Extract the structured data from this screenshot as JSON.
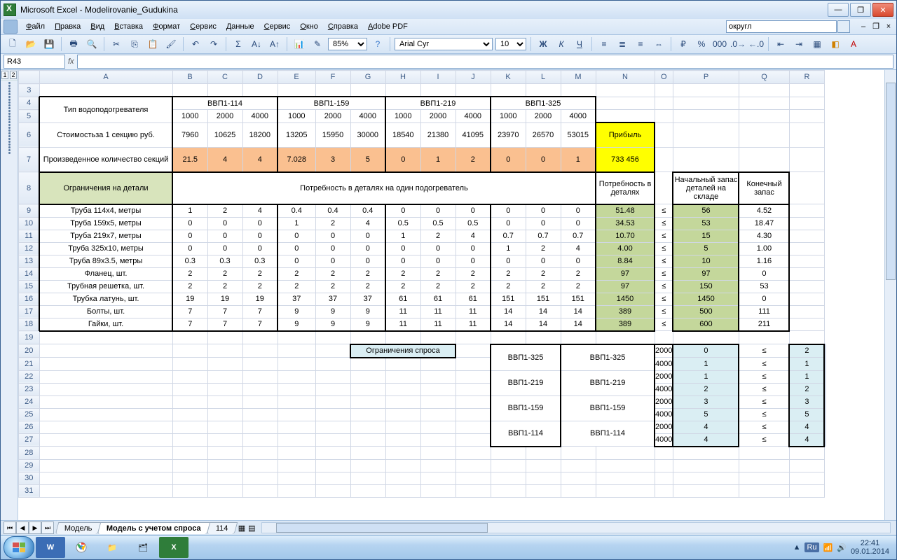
{
  "app_title": "Microsoft Excel - Modelirovanie_Gudukina",
  "menu": [
    "Файл",
    "Правка",
    "Вид",
    "Вставка",
    "Формат",
    "Сервис",
    "Данные",
    "Сервис",
    "Окно",
    "Справка",
    "Adobe PDF"
  ],
  "search_value": "округл",
  "zoom": "85%",
  "font_name": "Arial Cyr",
  "font_size": "10",
  "name_box": "R43",
  "columns": [
    "A",
    "B",
    "C",
    "D",
    "E",
    "F",
    "G",
    "H",
    "I",
    "J",
    "K",
    "L",
    "M",
    "N",
    "O",
    "P",
    "Q",
    "R"
  ],
  "row_start": 3,
  "row_end": 31,
  "labels": {
    "type": "Тип водоподогревателя",
    "cost": "Стоимостьза 1 секцию руб.",
    "produced": "Произведенное количество секций",
    "profit": "Прибыль",
    "profit_val": "733 456",
    "constraints": "Ограничения на детали",
    "need_per": "Потребность в деталях на один подогреватель",
    "need_total": "Потребность в деталях",
    "stock": "Начальный запас деталей на складе",
    "end_stock": "Конечный запас",
    "demand": "Ограничения спроса",
    "le": "≤"
  },
  "types": [
    "ВВП1-114",
    "ВВП1-159",
    "ВВП1-219",
    "ВВП1-325"
  ],
  "sizes": [
    "1000",
    "2000",
    "4000"
  ],
  "cost_row": [
    "7960",
    "10625",
    "18200",
    "13205",
    "15950",
    "30000",
    "18540",
    "21380",
    "41095",
    "23970",
    "26570",
    "53015"
  ],
  "prod_row": [
    "21.5",
    "4",
    "4",
    "7.028",
    "3",
    "5",
    "0",
    "1",
    "2",
    "0",
    "0",
    "1"
  ],
  "parts": [
    {
      "n": "Труба 114х4, метры",
      "v": [
        "1",
        "2",
        "4",
        "0.4",
        "0.4",
        "0.4",
        "0",
        "0",
        "0",
        "0",
        "0",
        "0"
      ],
      "need": "51.48",
      "stock": "56",
      "end": "4.52"
    },
    {
      "n": "Труба 159х5, метры",
      "v": [
        "0",
        "0",
        "0",
        "1",
        "2",
        "4",
        "0.5",
        "0.5",
        "0.5",
        "0",
        "0",
        "0"
      ],
      "need": "34.53",
      "stock": "53",
      "end": "18.47"
    },
    {
      "n": "Труба 219х7, метры",
      "v": [
        "0",
        "0",
        "0",
        "0",
        "0",
        "0",
        "1",
        "2",
        "4",
        "0.7",
        "0.7",
        "0.7"
      ],
      "need": "10.70",
      "stock": "15",
      "end": "4.30"
    },
    {
      "n": "Труба 325х10, метры",
      "v": [
        "0",
        "0",
        "0",
        "0",
        "0",
        "0",
        "0",
        "0",
        "0",
        "1",
        "2",
        "4"
      ],
      "need": "4.00",
      "stock": "5",
      "end": "1.00"
    },
    {
      "n": "Труба 89х3.5, метры",
      "v": [
        "0.3",
        "0.3",
        "0.3",
        "0",
        "0",
        "0",
        "0",
        "0",
        "0",
        "0",
        "0",
        "0"
      ],
      "need": "8.84",
      "stock": "10",
      "end": "1.16"
    },
    {
      "n": "Фланец, шт.",
      "v": [
        "2",
        "2",
        "2",
        "2",
        "2",
        "2",
        "2",
        "2",
        "2",
        "2",
        "2",
        "2"
      ],
      "need": "97",
      "stock": "97",
      "end": "0"
    },
    {
      "n": "Трубная решетка, шт.",
      "v": [
        "2",
        "2",
        "2",
        "2",
        "2",
        "2",
        "2",
        "2",
        "2",
        "2",
        "2",
        "2"
      ],
      "need": "97",
      "stock": "150",
      "end": "53"
    },
    {
      "n": "Трубка латунь, шт.",
      "v": [
        "19",
        "19",
        "19",
        "37",
        "37",
        "37",
        "61",
        "61",
        "61",
        "151",
        "151",
        "151"
      ],
      "need": "1450",
      "stock": "1450",
      "end": "0"
    },
    {
      "n": "Болты, шт.",
      "v": [
        "7",
        "7",
        "7",
        "9",
        "9",
        "9",
        "11",
        "11",
        "11",
        "14",
        "14",
        "14"
      ],
      "need": "389",
      "stock": "500",
      "end": "111"
    },
    {
      "n": "Гайки, шт.",
      "v": [
        "7",
        "7",
        "7",
        "9",
        "9",
        "9",
        "11",
        "11",
        "11",
        "14",
        "14",
        "14"
      ],
      "need": "389",
      "stock": "600",
      "end": "211"
    }
  ],
  "demand": [
    {
      "t": "ВВП1-325",
      "rows": [
        {
          "s": "2000",
          "a": "0",
          "b": "2"
        },
        {
          "s": "4000",
          "a": "1",
          "b": "1"
        }
      ]
    },
    {
      "t": "ВВП1-219",
      "rows": [
        {
          "s": "2000",
          "a": "1",
          "b": "1"
        },
        {
          "s": "4000",
          "a": "2",
          "b": "2"
        }
      ]
    },
    {
      "t": "ВВП1-159",
      "rows": [
        {
          "s": "2000",
          "a": "3",
          "b": "3"
        },
        {
          "s": "4000",
          "a": "5",
          "b": "5"
        }
      ]
    },
    {
      "t": "ВВП1-114",
      "rows": [
        {
          "s": "2000",
          "a": "4",
          "b": "4"
        },
        {
          "s": "4000",
          "a": "4",
          "b": "4"
        }
      ]
    }
  ],
  "sheets": [
    "Модель",
    "Модель с учетом спроса",
    "114"
  ],
  "active_sheet": 1,
  "tray": {
    "lang": "Ru",
    "time": "22:41",
    "date": "09.01.2014"
  }
}
